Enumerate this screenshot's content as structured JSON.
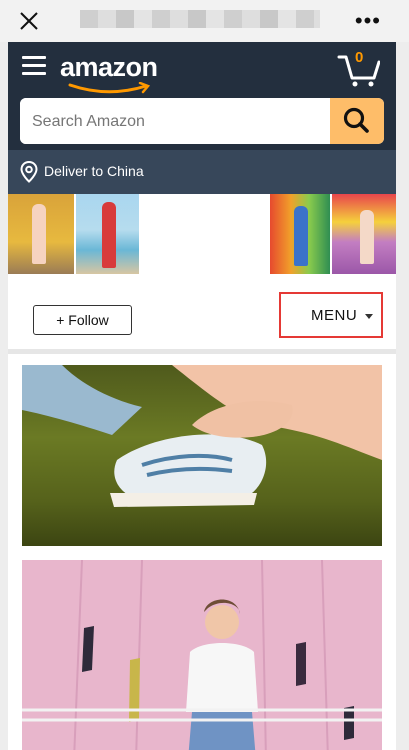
{
  "browser": {
    "close_icon": "close-icon",
    "more_icon": "more-dots-icon",
    "more_label": "•••"
  },
  "header": {
    "logo": "amazon",
    "cart_count": "0",
    "search_placeholder": "Search Amazon",
    "colors": {
      "header_bg": "#232f3e",
      "search_button": "#febd69",
      "cart_accent": "#ff9900"
    }
  },
  "deliver": {
    "label": "Deliver to China"
  },
  "store": {
    "follow_label": "+ Follow",
    "menu_label": "MENU"
  }
}
